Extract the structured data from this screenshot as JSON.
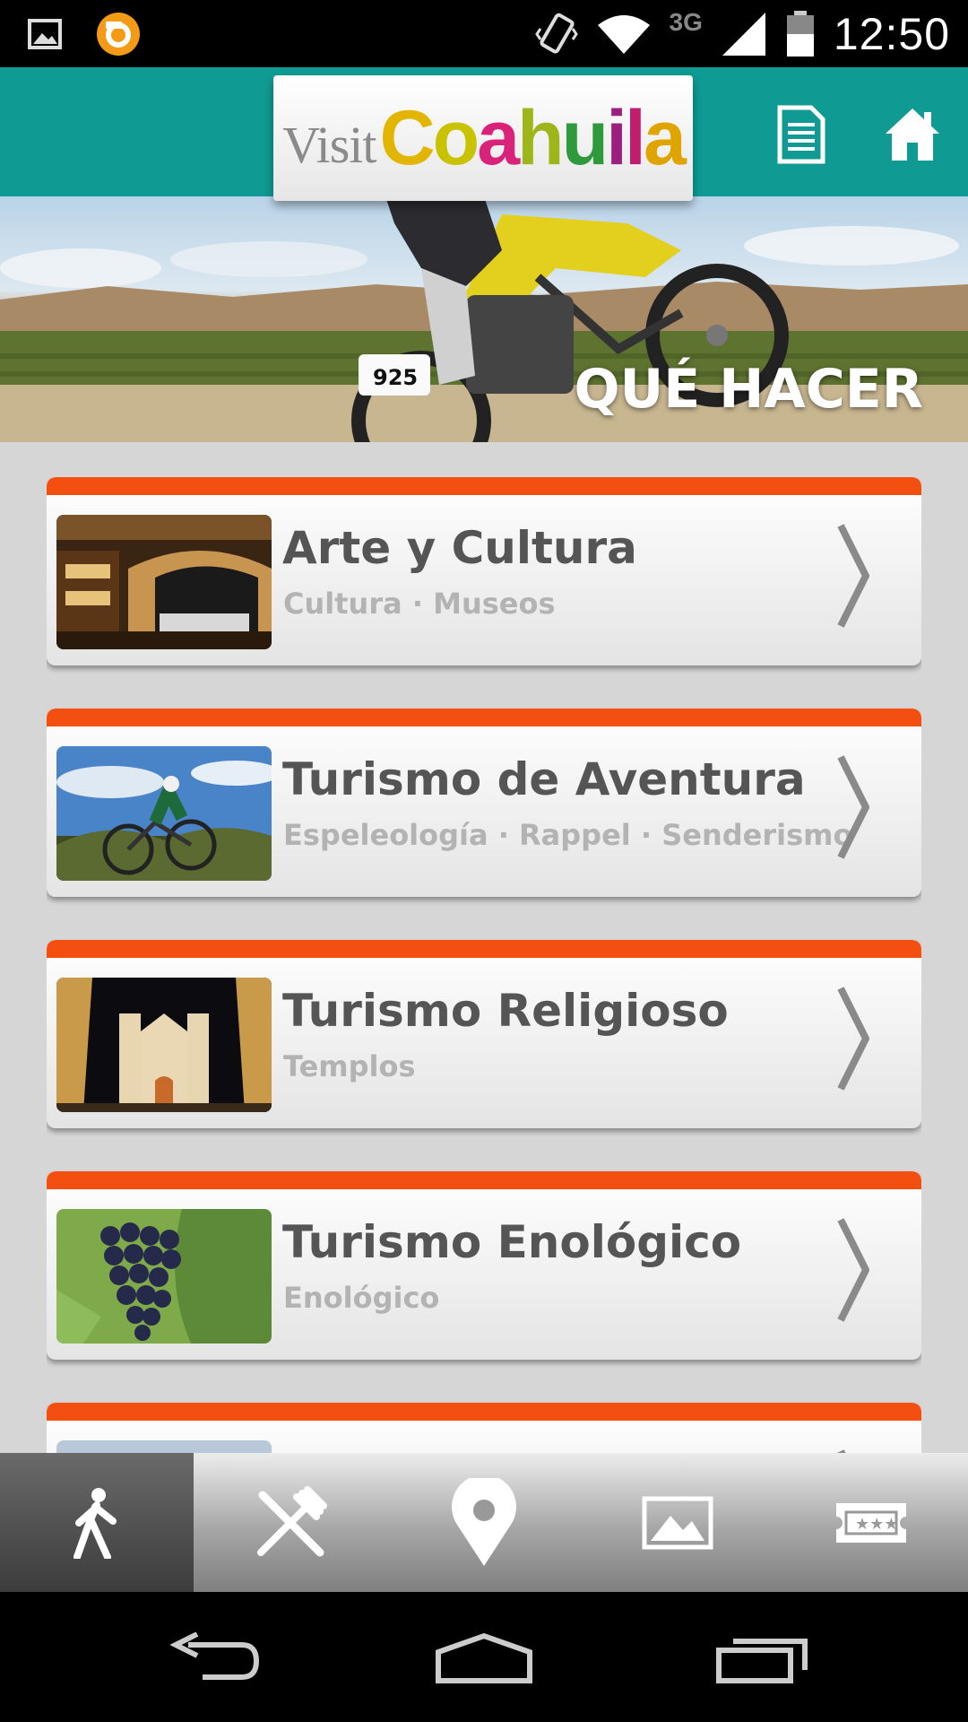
{
  "status_bar": {
    "time": "12:50",
    "network": "3G",
    "icons": [
      "image-notification-icon",
      "app-notification-icon",
      "vibrate-icon",
      "wifi-icon",
      "signal-icon",
      "battery-icon"
    ]
  },
  "header": {
    "logo_visit": "Visit",
    "logo_brand": [
      "C",
      "o",
      "a",
      "h",
      "u",
      "i",
      "l",
      "a"
    ],
    "icons": [
      "document-icon",
      "home-icon"
    ],
    "accent_color": "#0f9a93"
  },
  "hero": {
    "title": "QUÉ HACER",
    "plate_number": "925"
  },
  "categories": [
    {
      "title": "Arte y Cultura",
      "subtitle": "Cultura · Museos",
      "thumb": "theater-image"
    },
    {
      "title": "Turismo de Aventura",
      "subtitle": "Espeleología · Rappel · Senderismo",
      "thumb": "cyclist-image"
    },
    {
      "title": "Turismo Religioso",
      "subtitle": "Templos",
      "thumb": "church-image"
    },
    {
      "title": "Turismo Enológico",
      "subtitle": "Enológico",
      "thumb": "grapes-image"
    },
    {
      "title": "",
      "subtitle": "",
      "thumb": "partial-image"
    }
  ],
  "card_accent_color": "#f24f10",
  "tabs": [
    {
      "icon": "walking-icon",
      "active": true
    },
    {
      "icon": "fork-knife-icon",
      "active": false
    },
    {
      "icon": "map-pin-icon",
      "active": false
    },
    {
      "icon": "gallery-icon",
      "active": false
    },
    {
      "icon": "ticket-icon",
      "active": false
    }
  ],
  "navigation": [
    "back-icon",
    "home-nav-icon",
    "recents-icon"
  ]
}
